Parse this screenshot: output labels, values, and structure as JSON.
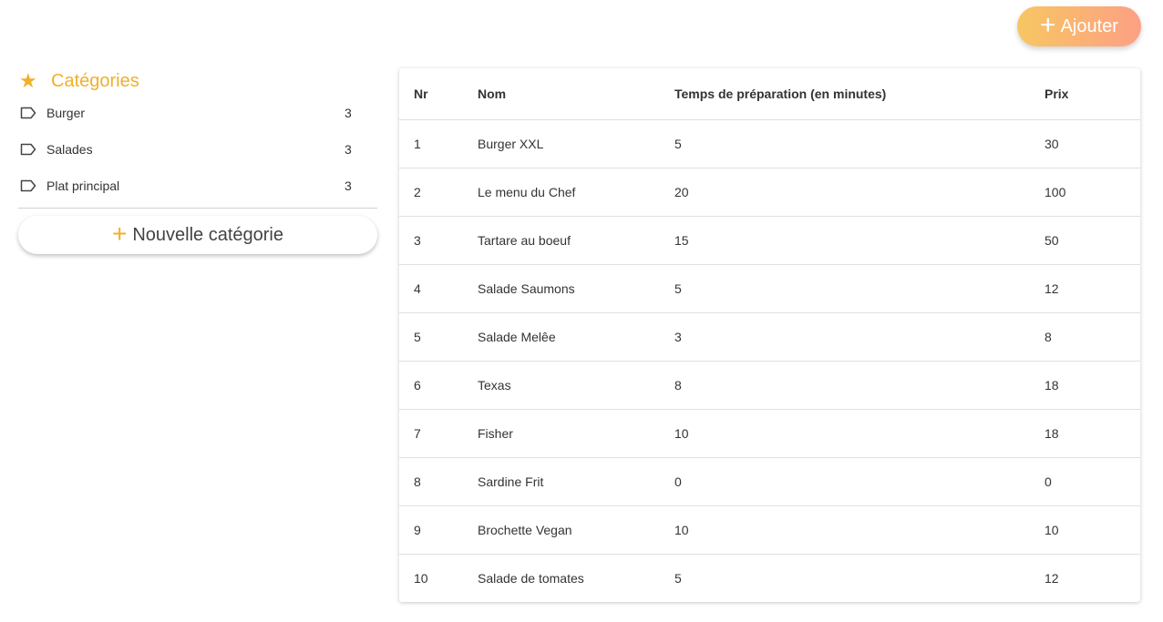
{
  "toolbar": {
    "add_label": "Ajouter"
  },
  "sidebar": {
    "title": "Catégories",
    "items": [
      {
        "label": "Burger",
        "count": "3"
      },
      {
        "label": "Salades",
        "count": "3"
      },
      {
        "label": "Plat principal",
        "count": "3"
      }
    ],
    "new_category_label": "Nouvelle catégorie"
  },
  "table": {
    "headers": [
      "Nr",
      "Nom",
      "Temps de préparation (en minutes)",
      "Prix"
    ],
    "rows": [
      [
        "1",
        "Burger XXL",
        "5",
        "30"
      ],
      [
        "2",
        "Le menu du Chef",
        "20",
        "100"
      ],
      [
        "3",
        "Tartare au boeuf",
        "15",
        "50"
      ],
      [
        "4",
        "Salade Saumons",
        "5",
        "12"
      ],
      [
        "5",
        "Salade Melêe",
        "3",
        "8"
      ],
      [
        "6",
        "Texas",
        "8",
        "18"
      ],
      [
        "7",
        "Fisher",
        "10",
        "18"
      ],
      [
        "8",
        "Sardine Frit",
        "0",
        "0"
      ],
      [
        "9",
        "Brochette Vegan",
        "10",
        "10"
      ],
      [
        "10",
        "Salade de tomates",
        "5",
        "12"
      ]
    ]
  },
  "colors": {
    "accent": "#f0b02a",
    "button_gradient_start": "#f7c662",
    "button_gradient_end": "#fda084"
  }
}
